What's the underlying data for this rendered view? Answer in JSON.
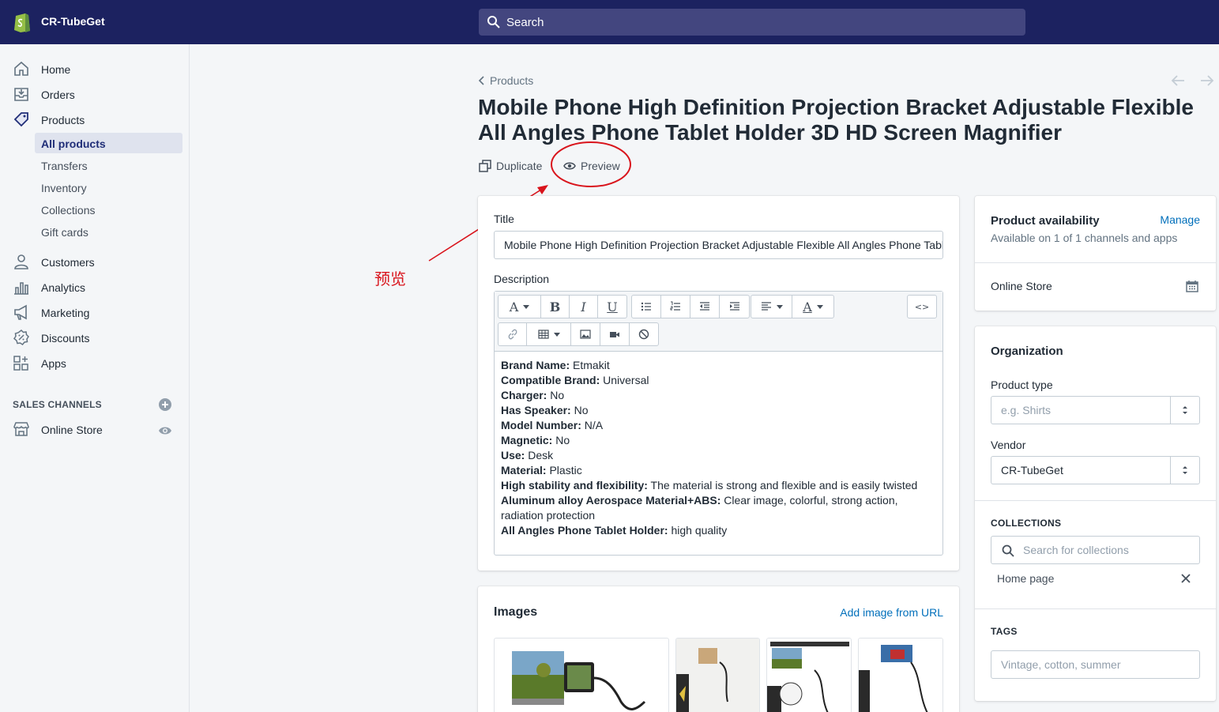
{
  "header": {
    "store_name": "CR-TubeGet",
    "search_placeholder": "Search"
  },
  "sidebar": {
    "items": [
      {
        "label": "Home",
        "icon": "home-icon"
      },
      {
        "label": "Orders",
        "icon": "orders-icon"
      },
      {
        "label": "Products",
        "icon": "tag-icon"
      },
      {
        "label": "Customers",
        "icon": "customer-icon"
      },
      {
        "label": "Analytics",
        "icon": "analytics-icon"
      },
      {
        "label": "Marketing",
        "icon": "megaphone-icon"
      },
      {
        "label": "Discounts",
        "icon": "discount-icon"
      },
      {
        "label": "Apps",
        "icon": "apps-icon"
      }
    ],
    "product_subitems": [
      "All products",
      "Transfers",
      "Inventory",
      "Collections",
      "Gift cards"
    ],
    "sales_channels_heading": "SALES CHANNELS",
    "channels": [
      {
        "label": "Online Store",
        "icon": "store-icon"
      }
    ]
  },
  "page": {
    "breadcrumb": "Products",
    "title": "Mobile Phone High Definition Projection Bracket Adjustable Flexible All Angles Phone Tablet Holder 3D HD Screen Magnifier",
    "actions": {
      "duplicate": "Duplicate",
      "preview": "Preview"
    }
  },
  "annotation": {
    "text": "预览",
    "color": "#d9141c"
  },
  "product_form": {
    "title_label": "Title",
    "title_value": "Mobile Phone High Definition Projection Bracket Adjustable Flexible All Angles Phone Tablet Holder 3D HD Screen Magnifier",
    "description_label": "Description",
    "description": [
      {
        "key": "Brand Name:",
        "value": " Etmakit"
      },
      {
        "key": "Compatible Brand:",
        "value": " Universal"
      },
      {
        "key": "Charger:",
        "value": " No"
      },
      {
        "key": "Has Speaker:",
        "value": " No"
      },
      {
        "key": "Model Number:",
        "value": " N/A"
      },
      {
        "key": "Magnetic:",
        "value": " No"
      },
      {
        "key": "Use:",
        "value": " Desk"
      },
      {
        "key": "Material:",
        "value": " Plastic"
      },
      {
        "key": "High stability and flexibility:",
        "value": " The material is strong and flexible and is easily twisted"
      },
      {
        "key": "Aluminum alloy Aerospace Material+ABS:",
        "value": " Clear image, colorful, strong action, radiation protection"
      },
      {
        "key": "All Angles Phone Tablet Holder:",
        "value": " high quality"
      }
    ],
    "toolbar_glyphs": {
      "font": "A",
      "bold": "B",
      "italic": "I",
      "underline": "U",
      "color": "A",
      "code": "<>"
    }
  },
  "images_card": {
    "title": "Images",
    "add_url_link": "Add image from URL"
  },
  "availability": {
    "title": "Product availability",
    "manage_link": "Manage",
    "subtitle": "Available on 1 of 1 channels and apps",
    "channel": "Online Store"
  },
  "organization": {
    "title": "Organization",
    "product_type_label": "Product type",
    "product_type_placeholder": "e.g. Shirts",
    "vendor_label": "Vendor",
    "vendor_value": "CR-TubeGet",
    "collections_heading": "COLLECTIONS",
    "collections_placeholder": "Search for collections",
    "collection_items": [
      "Home page"
    ],
    "tags_heading": "TAGS",
    "tags_placeholder": "Vintage, cotton, summer"
  },
  "colors": {
    "topbar": "#1c2260",
    "link": "#006fbb",
    "active_nav": "#202e78",
    "annotation": "#d9141c"
  }
}
